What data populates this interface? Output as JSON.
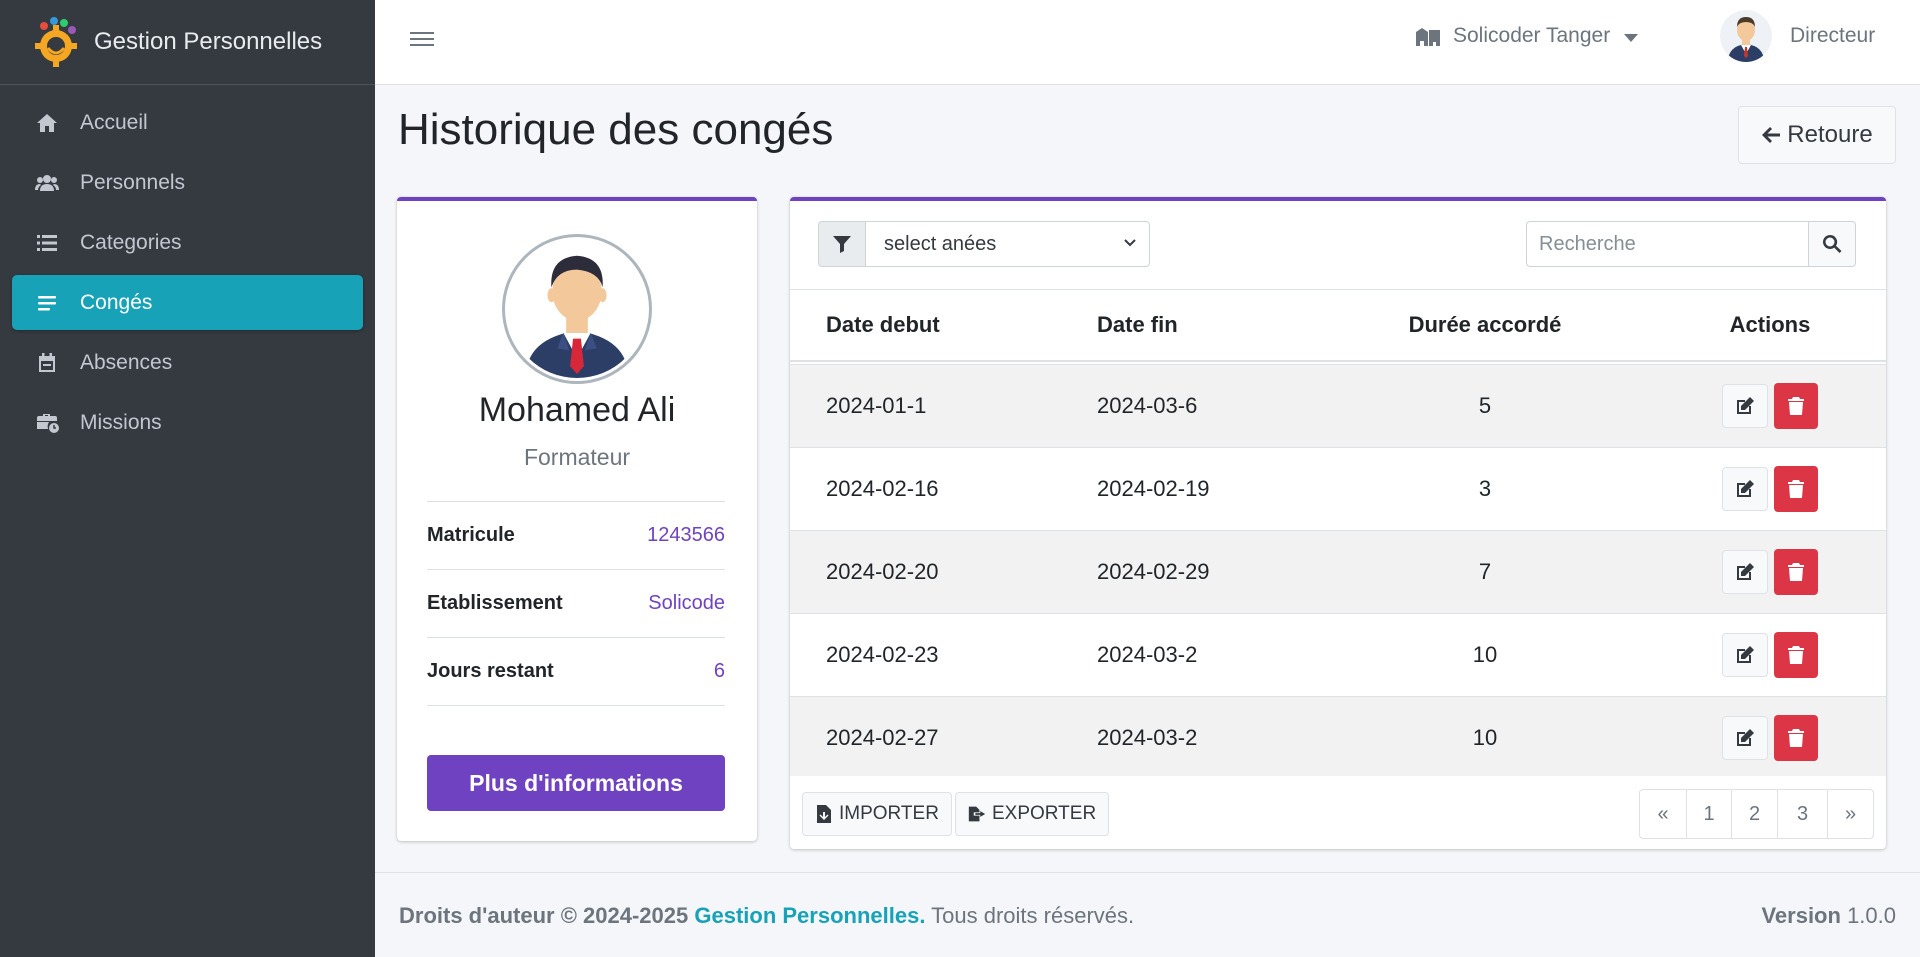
{
  "app": {
    "title": "Gestion Personnelles"
  },
  "sidebar": {
    "items": [
      {
        "label": "Accueil",
        "icon": "home-icon",
        "active": false
      },
      {
        "label": "Personnels",
        "icon": "users-icon",
        "active": false
      },
      {
        "label": "Categories",
        "icon": "list-icon",
        "active": false
      },
      {
        "label": "Congés",
        "icon": "bars-icon",
        "active": true
      },
      {
        "label": "Absences",
        "icon": "calendar-icon",
        "active": false
      },
      {
        "label": "Missions",
        "icon": "briefcase-clock-icon",
        "active": false
      }
    ]
  },
  "topbar": {
    "etablissement": "Solicoder Tanger",
    "user": "Directeur"
  },
  "page": {
    "title": "Historique des congés",
    "back_label": "Retoure"
  },
  "profile": {
    "name": "Mohamed Ali",
    "role": "Formateur",
    "fields": [
      {
        "label": "Matricule",
        "value": "1243566"
      },
      {
        "label": "Etablissement",
        "value": "Solicode"
      },
      {
        "label": "Jours restant",
        "value": "6"
      }
    ],
    "more_label": "Plus d'informations"
  },
  "filters": {
    "year_select": "select anées",
    "search_placeholder": "Recherche"
  },
  "table": {
    "headers": [
      "Date debut",
      "Date fin",
      "Durée accordé",
      "Actions"
    ],
    "rows": [
      [
        "2024-01-1",
        "2024-03-6",
        "5"
      ],
      [
        "2024-02-16",
        "2024-02-19",
        "3"
      ],
      [
        "2024-02-20",
        "2024-02-29",
        "7"
      ],
      [
        "2024-02-23",
        "2024-03-2",
        "10"
      ],
      [
        "2024-02-27",
        "2024-03-2",
        "10"
      ]
    ]
  },
  "footer_actions": {
    "import_label": "IMPORTER",
    "export_label": "EXPORTER"
  },
  "pagination": [
    "«",
    "1",
    "2",
    "3",
    "»"
  ],
  "footer": {
    "copyright_prefix": "Droits d'auteur © 2024-2025",
    "brand": "Gestion Personnelles.",
    "rights": "Tous droits réservés.",
    "version_label": "Version",
    "version_value": "1.0.0"
  },
  "colors": {
    "sidebar_bg": "#343a40",
    "active": "#17a2b8",
    "accent": "#6f42c1",
    "danger": "#dc3545"
  }
}
